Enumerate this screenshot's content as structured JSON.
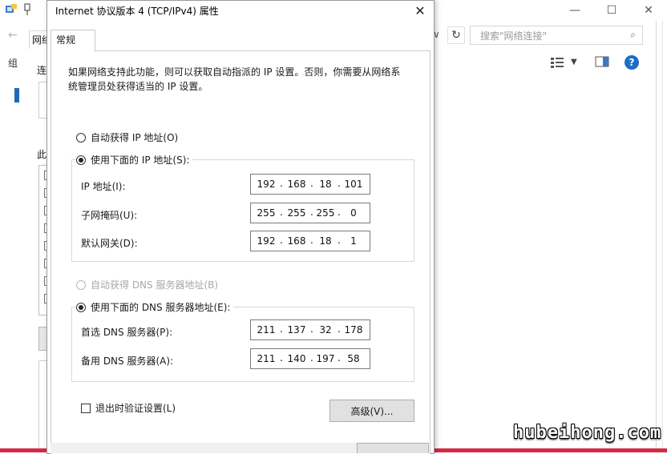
{
  "background_window": {
    "tab_label": "网络",
    "connect_label": "连",
    "section_label": "此",
    "cmd_char": "组",
    "search_placeholder": "搜索\"网络连接\"",
    "back_arrow": "←",
    "dropdown_arrow": "∨",
    "refresh_icon": "↻",
    "search_icon": "⌕",
    "view_arrow": "▼",
    "help_glyph": "?",
    "minimize_glyph": "—",
    "maximize_glyph": "☐",
    "close_glyph": "✕"
  },
  "dialog": {
    "title": "Internet 协议版本 4 (TCP/IPv4) 属性",
    "close_glyph": "✕",
    "tab_general": "常规",
    "description": "如果网络支持此功能，则可以获取自动指派的 IP 设置。否则，你需要从网络系统管理员处获得适当的 IP 设置。",
    "ip_auto_label": "自动获得 IP 地址(O)",
    "ip_manual_label": "使用下面的 IP 地址(S):",
    "ip_address_label": "IP 地址(I):",
    "subnet_label": "子网掩码(U):",
    "gateway_label": "默认网关(D):",
    "ip_address": [
      "192",
      "168",
      "18",
      "101"
    ],
    "subnet_mask": [
      "255",
      "255",
      "255",
      "0"
    ],
    "gateway": [
      "192",
      "168",
      "18",
      "1"
    ],
    "dns_auto_label": "自动获得 DNS 服务器地址(B)",
    "dns_manual_label": "使用下面的 DNS 服务器地址(E):",
    "dns_preferred_label": "首选 DNS 服务器(P):",
    "dns_alternate_label": "备用 DNS 服务器(A):",
    "dns_preferred": [
      "211",
      "137",
      "32",
      "178"
    ],
    "dns_alternate": [
      "211",
      "140",
      "197",
      "58"
    ],
    "validate_label": "退出时验证设置(L)",
    "advanced_button": "高级(V)..."
  },
  "watermark": "hubeihong.com",
  "colors": {
    "help_blue": "#1b6ec2",
    "bottom_bar": "#d42a4a"
  }
}
